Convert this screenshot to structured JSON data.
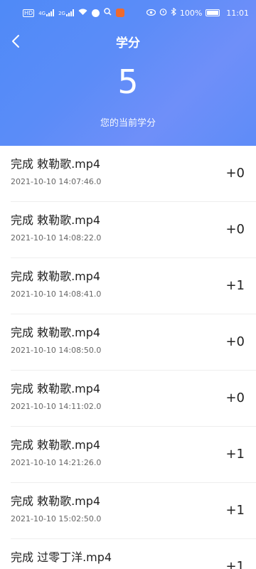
{
  "status_bar": {
    "network_label": "HD",
    "signal_label_1": "4G",
    "signal_label_2": "2G",
    "battery": "100%",
    "time": "11:01"
  },
  "header": {
    "title": "学分",
    "score": "5",
    "score_label": "您的当前学分"
  },
  "records": [
    {
      "title": "完成 敕勒歌.mp4",
      "time": "2021-10-10 14:07:46.0",
      "points": "+0"
    },
    {
      "title": "完成 敕勒歌.mp4",
      "time": "2021-10-10 14:08:22.0",
      "points": "+0"
    },
    {
      "title": "完成 敕勒歌.mp4",
      "time": "2021-10-10 14:08:41.0",
      "points": "+1"
    },
    {
      "title": "完成 敕勒歌.mp4",
      "time": "2021-10-10 14:08:50.0",
      "points": "+0"
    },
    {
      "title": "完成 敕勒歌.mp4",
      "time": "2021-10-10 14:11:02.0",
      "points": "+0"
    },
    {
      "title": "完成 敕勒歌.mp4",
      "time": "2021-10-10 14:21:26.0",
      "points": "+1"
    },
    {
      "title": "完成 敕勒歌.mp4",
      "time": "2021-10-10 15:02:50.0",
      "points": "+1"
    },
    {
      "title": "完成 过零丁洋.mp4",
      "time": "",
      "points": "+1"
    }
  ],
  "colors": {
    "header_bg": "#5b8cf8",
    "text_primary": "#222222",
    "text_secondary": "#666666"
  }
}
